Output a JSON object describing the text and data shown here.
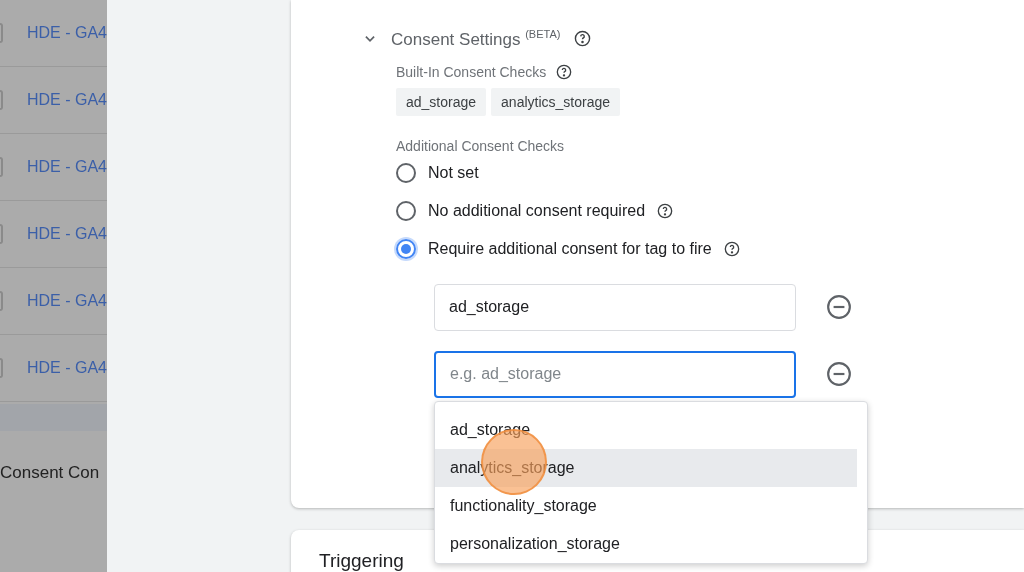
{
  "background_list": {
    "rows": [
      {
        "label": "HDE - GA4",
        "checked": false
      },
      {
        "label": "HDE - GA4",
        "checked": false
      },
      {
        "label": "HDE - GA4",
        "checked": false
      },
      {
        "label": "HDE - GA4",
        "checked": false
      },
      {
        "label": "HDE - GA4",
        "checked": false
      },
      {
        "label": "HDE - GA4",
        "checked": false
      }
    ],
    "footer_label": "Consent Con"
  },
  "consent_settings": {
    "title": "Consent Settings $^{(BETA)}$",
    "expanded": true,
    "built_in": {
      "label": "Built-In Consent Checks",
      "chips": [
        "ad_storage",
        "analytics_storage"
      ]
    },
    "additional": {
      "label": "Additional Consent Checks",
      "options": [
        {
          "label": "Not set",
          "selected": false,
          "help": false
        },
        {
          "label": "No additional consent required",
          "selected": false,
          "help": true
        },
        {
          "label": "Require additional consent for tag to fire",
          "selected": true,
          "help": true
        }
      ]
    },
    "fields": [
      {
        "value": "ad_storage",
        "focused": false
      },
      {
        "placeholder": "e.g. ad_storage",
        "focused": true
      }
    ],
    "suggestions": [
      {
        "label": "ad_storage",
        "selected": false
      },
      {
        "label": "analytics_storage",
        "selected": true
      },
      {
        "label": "functionality_storage",
        "selected": false
      },
      {
        "label": "personalization_storage",
        "selected": false
      }
    ]
  },
  "triggering": {
    "title": "Triggering"
  }
}
